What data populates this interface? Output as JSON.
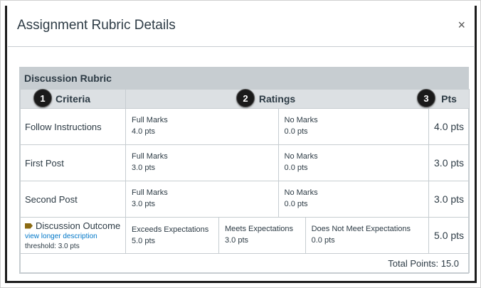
{
  "dialog": {
    "title": "Assignment Rubric Details",
    "close_label": "×"
  },
  "rubric": {
    "title": "Discussion Rubric",
    "headers": {
      "criteria": "Criteria",
      "ratings": "Ratings",
      "pts": "Pts"
    },
    "callouts": [
      "1",
      "2",
      "3"
    ],
    "rows": [
      {
        "criterion": "Follow Instructions",
        "ratings": [
          {
            "label": "Full Marks",
            "pts": "4.0 pts"
          },
          {
            "label": "No Marks",
            "pts": "0.0 pts"
          }
        ],
        "pts": "4.0 pts"
      },
      {
        "criterion": "First Post",
        "ratings": [
          {
            "label": "Full Marks",
            "pts": "3.0 pts"
          },
          {
            "label": "No Marks",
            "pts": "0.0 pts"
          }
        ],
        "pts": "3.0 pts"
      },
      {
        "criterion": "Second Post",
        "ratings": [
          {
            "label": "Full Marks",
            "pts": "3.0 pts"
          },
          {
            "label": "No Marks",
            "pts": "0.0 pts"
          }
        ],
        "pts": "3.0 pts"
      },
      {
        "criterion": "Discussion Outcome",
        "link": "view longer description",
        "threshold": "threshold: 3.0 pts",
        "ratings": [
          {
            "label": "Exceeds Expectations",
            "pts": "5.0 pts"
          },
          {
            "label": "Meets Expectations",
            "pts": "3.0 pts"
          },
          {
            "label": "Does Not Meet Expectations",
            "pts": "0.0 pts"
          }
        ],
        "pts": "5.0 pts"
      }
    ],
    "total": "Total Points: 15.0"
  },
  "colors": {
    "header_bg": "#c7cdd1",
    "link": "#0077c8",
    "outcome_icon": "#8b6a12"
  }
}
